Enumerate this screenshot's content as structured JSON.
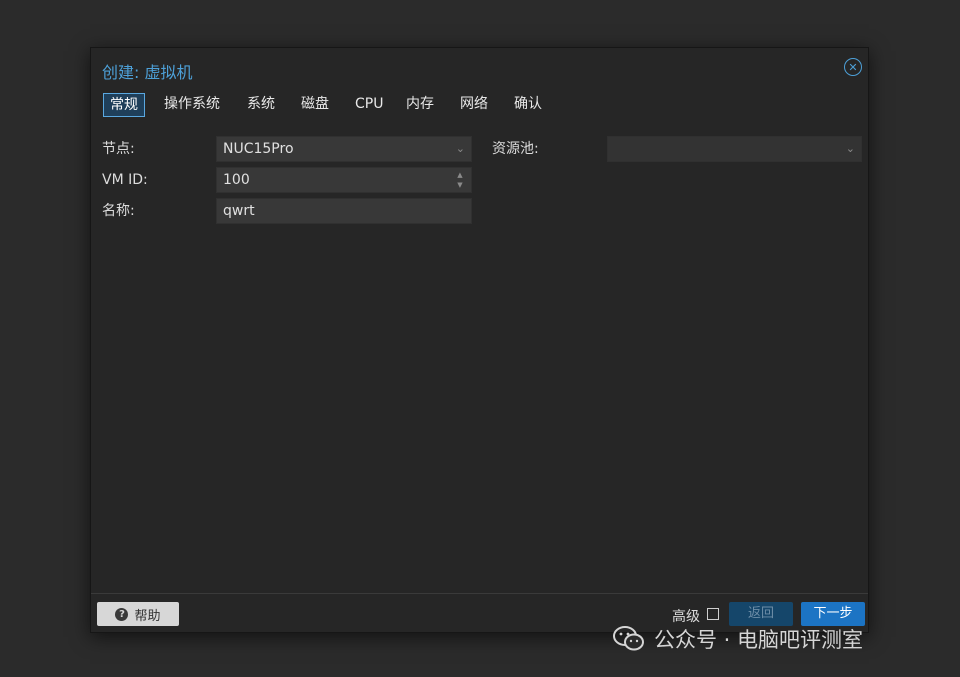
{
  "dialog": {
    "title": "创建: 虚拟机",
    "close_icon": "close-circle-icon"
  },
  "tabs": [
    {
      "label": "常规",
      "active": true
    },
    {
      "label": "操作系统"
    },
    {
      "label": "系统"
    },
    {
      "label": "磁盘"
    },
    {
      "label": "CPU"
    },
    {
      "label": "内存"
    },
    {
      "label": "网络"
    },
    {
      "label": "确认"
    }
  ],
  "form": {
    "node": {
      "label": "节点:",
      "value": "NUC15Pro"
    },
    "vmid": {
      "label": "VM ID:",
      "value": "100"
    },
    "name": {
      "label": "名称:",
      "value": "qwrt"
    },
    "pool": {
      "label": "资源池:",
      "value": ""
    }
  },
  "footer": {
    "help_label": "帮助",
    "advanced_label": "高级",
    "advanced_checked": false,
    "back_label": "返回",
    "next_label": "下一步"
  },
  "watermark": {
    "text": "公众号 · 电脑吧评测室"
  },
  "colors": {
    "accent": "#4da0d8",
    "primary_button": "#1c74c4",
    "background": "#262626"
  }
}
